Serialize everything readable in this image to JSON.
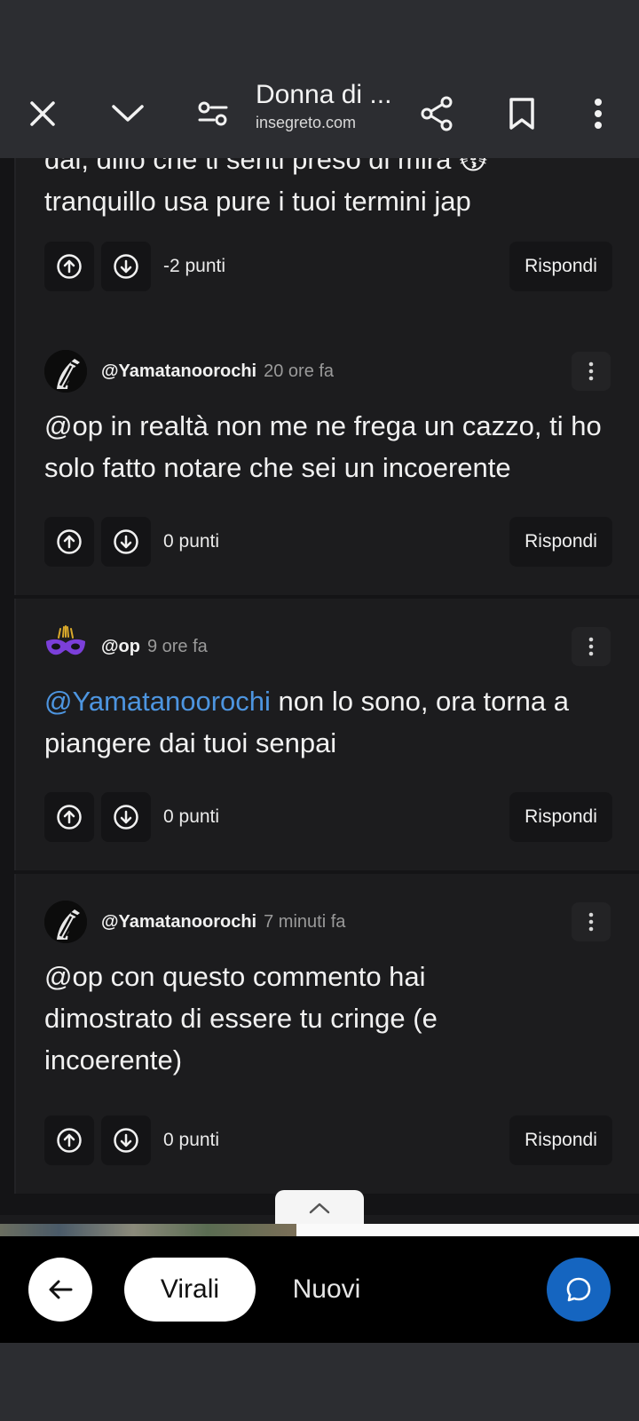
{
  "toolbar": {
    "title": "Donna di ...",
    "domain": "insegreto.com"
  },
  "comments": [
    {
      "text_line1": "dai, dillo che ti senti preso di mira 😽",
      "text_line2": "tranquillo usa pure i tuoi termini jap",
      "points": "-2 punti",
      "reply": "Rispondi"
    },
    {
      "username": "@Yamatanoorochi",
      "time": "20 ore fa",
      "text": "@op in realtà non me ne frega un cazzo, ti ho solo fatto notare che sei un incoerente",
      "points": "0 punti",
      "reply": "Rispondi"
    },
    {
      "username": "@op",
      "time": "9 ore fa",
      "mention": "@Yamatanoorochi",
      "text": " non lo sono, ora torna a piangere dai tuoi senpai",
      "points": "0 punti",
      "reply": "Rispondi"
    },
    {
      "username": "@Yamatanoorochi",
      "time": "7 minuti fa",
      "text": "@op con questo commento hai dimostrato di essere tu cringe (e incoerente)",
      "points": "0 punti",
      "reply": "Rispondi"
    }
  ],
  "bottom_nav": {
    "virali": "Virali",
    "nuovi": "Nuovi"
  },
  "colors": {
    "accent": "#1565c0",
    "mention": "#4d95e0",
    "background": "#1c1c1e",
    "toolbar": "#2c2d31"
  },
  "icons": [
    "close-icon",
    "chevron-down-icon",
    "filter-icon",
    "share-icon",
    "bookmark-icon",
    "more-vert-icon",
    "upvote-icon",
    "downvote-icon",
    "arrow-left-icon",
    "chat-icon",
    "chevron-up-icon",
    "zebra-avatar",
    "mask-avatar"
  ]
}
